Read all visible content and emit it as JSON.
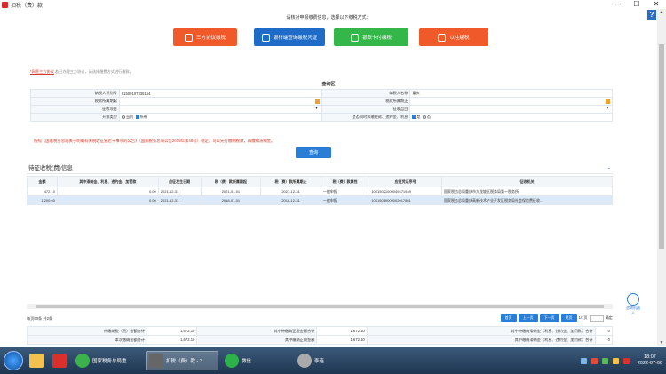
{
  "window": {
    "title": "扣税（费）款",
    "minimize": "—",
    "maximize": "☐",
    "close": "✕"
  },
  "help_label": "?",
  "prompt": "请核对申报缴费信息，选择以下缴税方式：",
  "pay_methods": [
    {
      "label": "三方协议缴税",
      "color": "#f0592a",
      "icon": "layers-icon"
    },
    {
      "label": "银行端查询缴税凭证",
      "color": "#1f6cc8",
      "icon": "bank-icon"
    },
    {
      "label": "银联卡付缴税",
      "color": "#34b648",
      "icon": "card-icon"
    },
    {
      "label": "以往缴税",
      "color": "#f0592a",
      "icon": "coin-icon"
    }
  ],
  "note": {
    "link": "*网签三方协议",
    "text": "若已办理三方协议，请选择缴费方式进行缴款。"
  },
  "query_section": {
    "title": "查询区",
    "fields": {
      "taxpayer_id_label": "纳税人识别号",
      "taxpayer_id_value": "91500107335164",
      "taxpayer_name_label": "纳税人名称",
      "taxpayer_name_value": "重庆",
      "period_start_label": "税款所属期起",
      "period_end_label": "税款所属期止",
      "item_label": "征收项目",
      "subitem_label": "征收品目",
      "ticket_type_label": "开票类型",
      "ticket_opt_current": "当前",
      "ticket_opt_all": "所有",
      "overdue_label": "是否同时扣缴税款、违约金、利息",
      "overdue_yes": "是",
      "overdue_no": "否"
    },
    "red_tip": "按照《国家税务总局关于明确有关税收征管若干事项的公告》（国家税务总局公告2019年第48号）规定，可以先行缴纳税款，再缴纳滞纳金。",
    "query_button": "查询"
  },
  "grid": {
    "title": "待征收税(费)信息",
    "headers": [
      "金额",
      "其中滞纳金、利息、违约金、加罚款",
      "应征发生日期",
      "税（费）款所属期起",
      "税（费）款所属期止",
      "税（费）款属性",
      "应征凭证序号",
      "征收机关"
    ],
    "rows": [
      [
        "472.10",
        "0.00",
        "2021-12-31",
        "2021-01-01",
        "2021-12-31",
        "一般申报",
        "10015021000049471939",
        "国家税务总局重庆市九龙坡区税务局第一税务所"
      ],
      [
        "1,200.00",
        "0.00",
        "2021-12-31",
        "2018-01-01",
        "2018-12-31",
        "一般申报",
        "10015019000002017861",
        "国家税务总局重庆高新技术产业开发区税务局社会保险费征收..."
      ]
    ]
  },
  "pager": {
    "info": "每页50条 共2条",
    "first": "首页",
    "prev": "上一页",
    "next": "下一页",
    "last": "尾页",
    "page_text": "1/1页",
    "go": "确定"
  },
  "totals": [
    {
      "l1": "待缴纳税（费）金额合计",
      "v1": "1,672.10",
      "l2": "其中待缴纳正税金额合计",
      "v2": "1,672.10",
      "l3": "其中待缴纳滞纳金（利息、违约金、加罚款）合计",
      "v3": "0"
    },
    {
      "l1": "本次缴纳金额合计",
      "v1": "1,672.10",
      "l2": "其中缴纳正税金额",
      "v2": "1,672.10",
      "l3": "其中缴纳滞纳金（利息、违约金、加罚款）合计",
      "v3": "0"
    }
  ],
  "robot_label": "咨询机器人",
  "taskbar": {
    "items": [
      {
        "label": "",
        "icon": "folder-icon",
        "color": "#f2c14e"
      },
      {
        "label": "",
        "icon": "wps-icon",
        "color": "#d9302c"
      },
      {
        "label": "国家税务总局重...",
        "icon": "browser-icon",
        "color": "#3bb34a"
      },
      {
        "label": "扣税（费）款 - 3...",
        "icon": "app-icon",
        "color": "#666"
      },
      {
        "label": "微信",
        "icon": "wechat-icon",
        "color": "#2db24a"
      },
      {
        "label": "李连",
        "icon": "avatar-icon",
        "color": "#aaa"
      }
    ],
    "time": "18:07",
    "date": "2022-07-06"
  }
}
